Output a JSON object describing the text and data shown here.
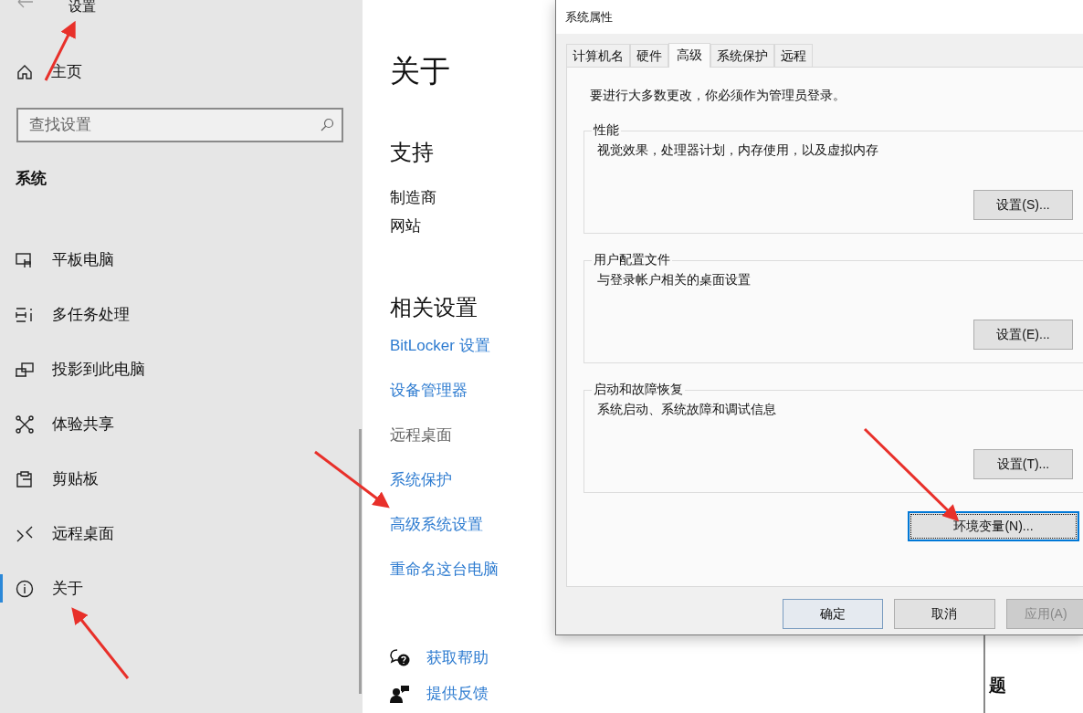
{
  "settings": {
    "title": "设置",
    "home": "主页",
    "search": {
      "placeholder": "查找设置"
    },
    "section": "系统",
    "nav_items": [
      {
        "label": "平板电脑",
        "selected": false
      },
      {
        "label": "多任务处理",
        "selected": false
      },
      {
        "label": "投影到此电脑",
        "selected": false
      },
      {
        "label": "体验共享",
        "selected": false
      },
      {
        "label": "剪贴板",
        "selected": false
      },
      {
        "label": "远程桌面",
        "selected": false
      },
      {
        "label": "关于",
        "selected": true
      }
    ]
  },
  "about": {
    "title": "关于",
    "support_heading": "支持",
    "info_rows": [
      {
        "label": "制造商"
      },
      {
        "label": "网站"
      }
    ],
    "related_heading": "相关设置",
    "related_links": [
      {
        "label": "BitLocker 设置",
        "disabled": false
      },
      {
        "label": "设备管理器",
        "disabled": false
      },
      {
        "label": "远程桌面",
        "disabled": true
      },
      {
        "label": "系统保护",
        "disabled": false
      },
      {
        "label": "高级系统设置",
        "disabled": false
      },
      {
        "label": "重命名这台电脑",
        "disabled": false
      }
    ],
    "help_links": [
      {
        "label": "获取帮助"
      },
      {
        "label": "提供反馈"
      }
    ],
    "side_heading": "题"
  },
  "dialog": {
    "title": "系统属性",
    "tabs": [
      {
        "label": "计算机名",
        "selected": false
      },
      {
        "label": "硬件",
        "selected": false
      },
      {
        "label": "高级",
        "selected": true
      },
      {
        "label": "系统保护",
        "selected": false
      },
      {
        "label": "远程",
        "selected": false
      }
    ],
    "admin_note": "要进行大多数更改，你必须作为管理员登录。",
    "groups": [
      {
        "title": "性能",
        "description": "视觉效果，处理器计划，内存使用，以及虚拟内存",
        "button": "设置(S)..."
      },
      {
        "title": "用户配置文件",
        "description": "与登录帐户相关的桌面设置",
        "button": "设置(E)..."
      },
      {
        "title": "启动和故障恢复",
        "description": "系统启动、系统故障和调试信息",
        "button": "设置(T)..."
      }
    ],
    "env_button": {
      "label": "环境变量(N)...",
      "focused": true
    },
    "footer_buttons": [
      {
        "label": "确定",
        "default": true,
        "disabled": false
      },
      {
        "label": "取消",
        "default": false,
        "disabled": false
      },
      {
        "label": "应用(A)",
        "default": false,
        "disabled": true
      }
    ]
  }
}
